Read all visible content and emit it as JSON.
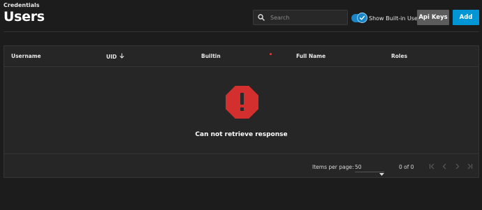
{
  "header": {
    "breadcrumb": "Credentials",
    "title": "Users"
  },
  "toolbar": {
    "search_placeholder": "Search",
    "search_value": "",
    "toggle_label": "Show Built-in Users",
    "toggle_on": true,
    "api_keys_label": "Api Keys",
    "add_label": "Add"
  },
  "table": {
    "columns": [
      {
        "label": "Username",
        "sort_icon": ""
      },
      {
        "label": "UID",
        "sort_icon": "arrow-down-icon"
      },
      {
        "label": "Builtin",
        "sort_icon": ""
      },
      {
        "label": "Full Name",
        "sort_icon": ""
      },
      {
        "label": "Roles",
        "sort_icon": ""
      }
    ],
    "empty_state": {
      "icon": "error-octagon-icon",
      "message": "Can not retrieve response"
    }
  },
  "paginator": {
    "items_per_page_label": "Items per page:",
    "items_per_page_value": "50",
    "range_label": "0 of 0"
  },
  "colors": {
    "background": "#1c1c1c",
    "card": "#262626",
    "accent_blue": "#0095d5",
    "toggle_blue": "#1a86c6",
    "api_keys_gray": "#5c5c5c",
    "error_red": "#d32f2f"
  }
}
